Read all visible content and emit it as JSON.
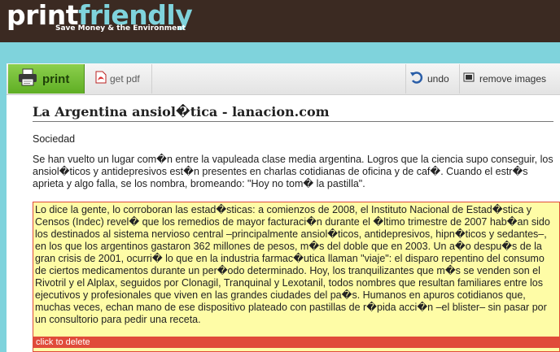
{
  "header": {
    "logo_print": "print",
    "logo_friendly": "friendly",
    "tagline": "Save Money & the Environment"
  },
  "toolbar": {
    "print_label": "print",
    "pdf_label": "get pdf",
    "undo_label": "undo",
    "remove_images_label": "remove images"
  },
  "article": {
    "title": "La Argentina ansiol�tica - lanacion.com",
    "section": "Sociedad",
    "intro": "Se han vuelto un lugar com�n entre la vapuleada clase media argentina. Logros que la ciencia supo conseguir, los ansiol�ticos y antidepresivos est�n presentes en charlas cotidianas de oficina y de caf�. Cuando el estr�s aprieta y algo falla, se los nombra, bromeando: \"Hoy no tom� la pastilla\".",
    "highlighted": "Lo dice la gente, lo corroboran las estad�sticas: a comienzos de 2008, el Instituto Nacional de Estad�stica y Censos (Indec) revel� que los remedios de mayor facturaci�n durante el �ltimo trimestre de 2007 hab�an sido los destinados al sistema nervioso central –principalmente ansiol�ticos, antidepresivos, hipn�ticos y sedantes–, en los que los argentinos gastaron 362 millones de pesos, m�s del doble que en 2003. Un a�o despu�s de la gran crisis de 2001, ocurri� lo que en la industria farmac�utica llaman \"viaje\": el disparo repentino del consumo de ciertos medicamentos durante un per�odo determinado. Hoy, los tranquilizantes que m�s se venden son el Rivotril y el Alplax, seguidos por Clonagil, Tranquinal y Lexotanil, todos nombres que resultan familiares entre los ejecutivos y profesionales que viven en las grandes ciudades del pa�s. Humanos en apuros cotidianos que, muchas veces, echan mano de ese dispositivo plateado con pastillas de r�pida acci�n –el blister– sin pasar por un consultorio para pedir una receta.",
    "delete_label": "click to delete"
  },
  "colors": {
    "header_bg": "#3b2a22",
    "accent_cyan": "#7fd3dc",
    "print_green": "#6cbb2c",
    "highlight_yellow": "#fefca6",
    "delete_red": "#e04b3a"
  },
  "icons": [
    "printer-icon",
    "pdf-icon",
    "undo-icon",
    "remove-images-icon"
  ]
}
